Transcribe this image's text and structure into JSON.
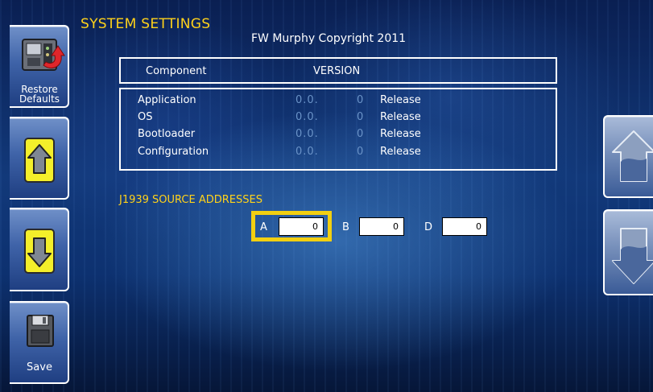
{
  "header": {
    "title": "SYSTEM SETTINGS",
    "copyright": "FW Murphy Copyright 2011"
  },
  "version_table": {
    "columns": [
      "Component",
      "VERSION"
    ],
    "rows": [
      {
        "component": "Application",
        "version": "0.0.",
        "build": "0",
        "status": "Release"
      },
      {
        "component": "OS",
        "version": "0.0.",
        "build": "0",
        "status": "Release"
      },
      {
        "component": "Bootloader",
        "version": "0.0.",
        "build": "0",
        "status": "Release"
      },
      {
        "component": "Configuration",
        "version": "0.0.",
        "build": "0",
        "status": "Release"
      }
    ]
  },
  "source_addresses": {
    "heading": "J1939 SOURCE ADDRESSES",
    "fields": [
      {
        "label": "A",
        "value": "0",
        "focused": true
      },
      {
        "label": "B",
        "value": "0",
        "focused": false
      },
      {
        "label": "D",
        "value": "0",
        "focused": false
      }
    ]
  },
  "left_buttons": {
    "restore_label_1": "Restore",
    "restore_label_2": "Defaults",
    "save_label": "Save"
  },
  "icons": {
    "restore": "restore-defaults-icon",
    "up": "up-arrow-icon",
    "down": "down-arrow-icon",
    "save": "save-icon",
    "page_up": "page-up-icon",
    "page_down": "page-down-icon"
  },
  "colors": {
    "accent_yellow": "#ffd21a",
    "focus_border": "#f2cf11",
    "background": "#12397a"
  }
}
